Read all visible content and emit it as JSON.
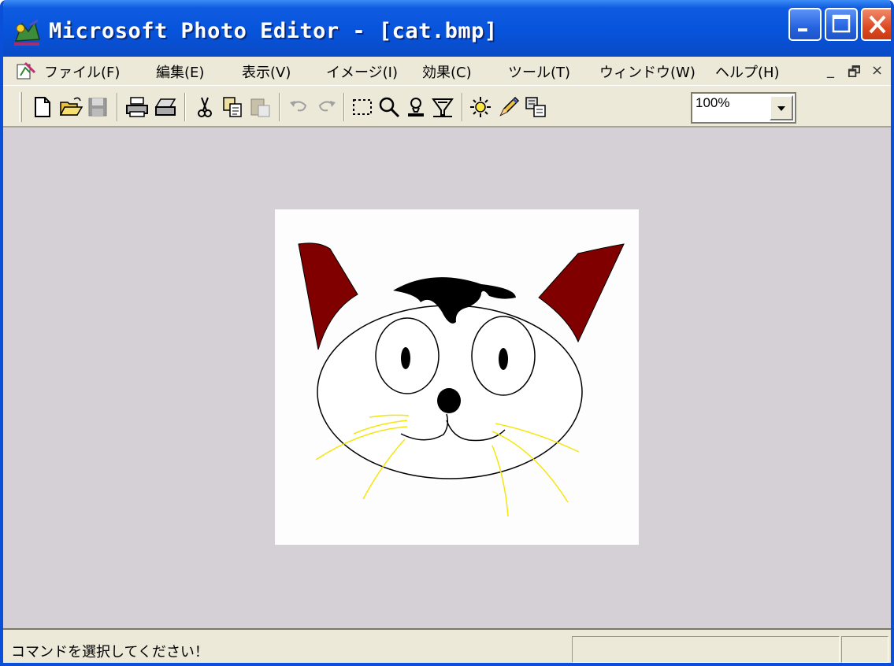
{
  "window": {
    "title": "Microsoft Photo Editor - [cat.bmp]"
  },
  "menu": {
    "items": [
      "ファイル(F)",
      "編集(E)",
      "表示(V)",
      "イメージ(I)",
      "効果(C)",
      "ツール(T)",
      "ウィンドウ(W)",
      "ヘルプ(H)"
    ],
    "mdi_controls": [
      "_",
      "🗗",
      "×"
    ]
  },
  "toolbar": {
    "zoom_value": "100%"
  },
  "canvas": {
    "file": "cat.bmp",
    "colors": {
      "ear": "#800000",
      "whisker": "#f5e60a",
      "outline": "#000000"
    }
  },
  "status": {
    "text": "コマンドを選択してください！"
  },
  "colors": {
    "titlebar": "#0754dc",
    "workspace": "#d4d0d6",
    "chrome": "#ece9d8"
  }
}
